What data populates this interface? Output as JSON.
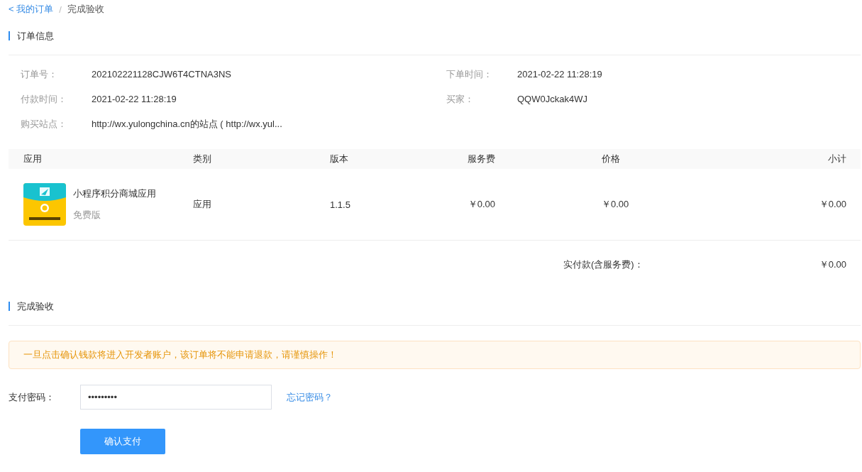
{
  "breadcrumb": {
    "back_link": "< 我的订单",
    "separator": "/",
    "current": "完成验收"
  },
  "order_info": {
    "title": "订单信息",
    "fields": [
      {
        "label": "订单号：",
        "value": "202102221128CJW6T4CTNA3NS"
      },
      {
        "label": "下单时间：",
        "value": "2021-02-22 11:28:19"
      },
      {
        "label": "付款时间：",
        "value": "2021-02-22 11:28:19"
      },
      {
        "label": "买家：",
        "value": "QQW0Jckak4WJ"
      },
      {
        "label": "购买站点：",
        "value": "http://wx.yulongchina.cn的站点 ( http://wx.yul..."
      }
    ]
  },
  "table": {
    "columns": [
      "应用",
      "类别",
      "版本",
      "服务费",
      "价格",
      "小计"
    ],
    "rows": [
      {
        "app_name": "小程序积分商城应用",
        "edition": "免费版",
        "category": "应用",
        "version": "1.1.5",
        "service_fee": "￥0.00",
        "price": "￥0.00",
        "subtotal": "￥0.00"
      }
    ],
    "total_label": "实付款(含服务费)：",
    "total_value": "￥0.00"
  },
  "acceptance": {
    "title": "完成验收",
    "warning": "一旦点击确认钱款将进入开发者账户，该订单将不能申请退款，请谨慎操作！",
    "password_label": "支付密码：",
    "password_value": "•••••••••",
    "forgot_link": "忘记密码？",
    "confirm_button": "确认支付"
  }
}
